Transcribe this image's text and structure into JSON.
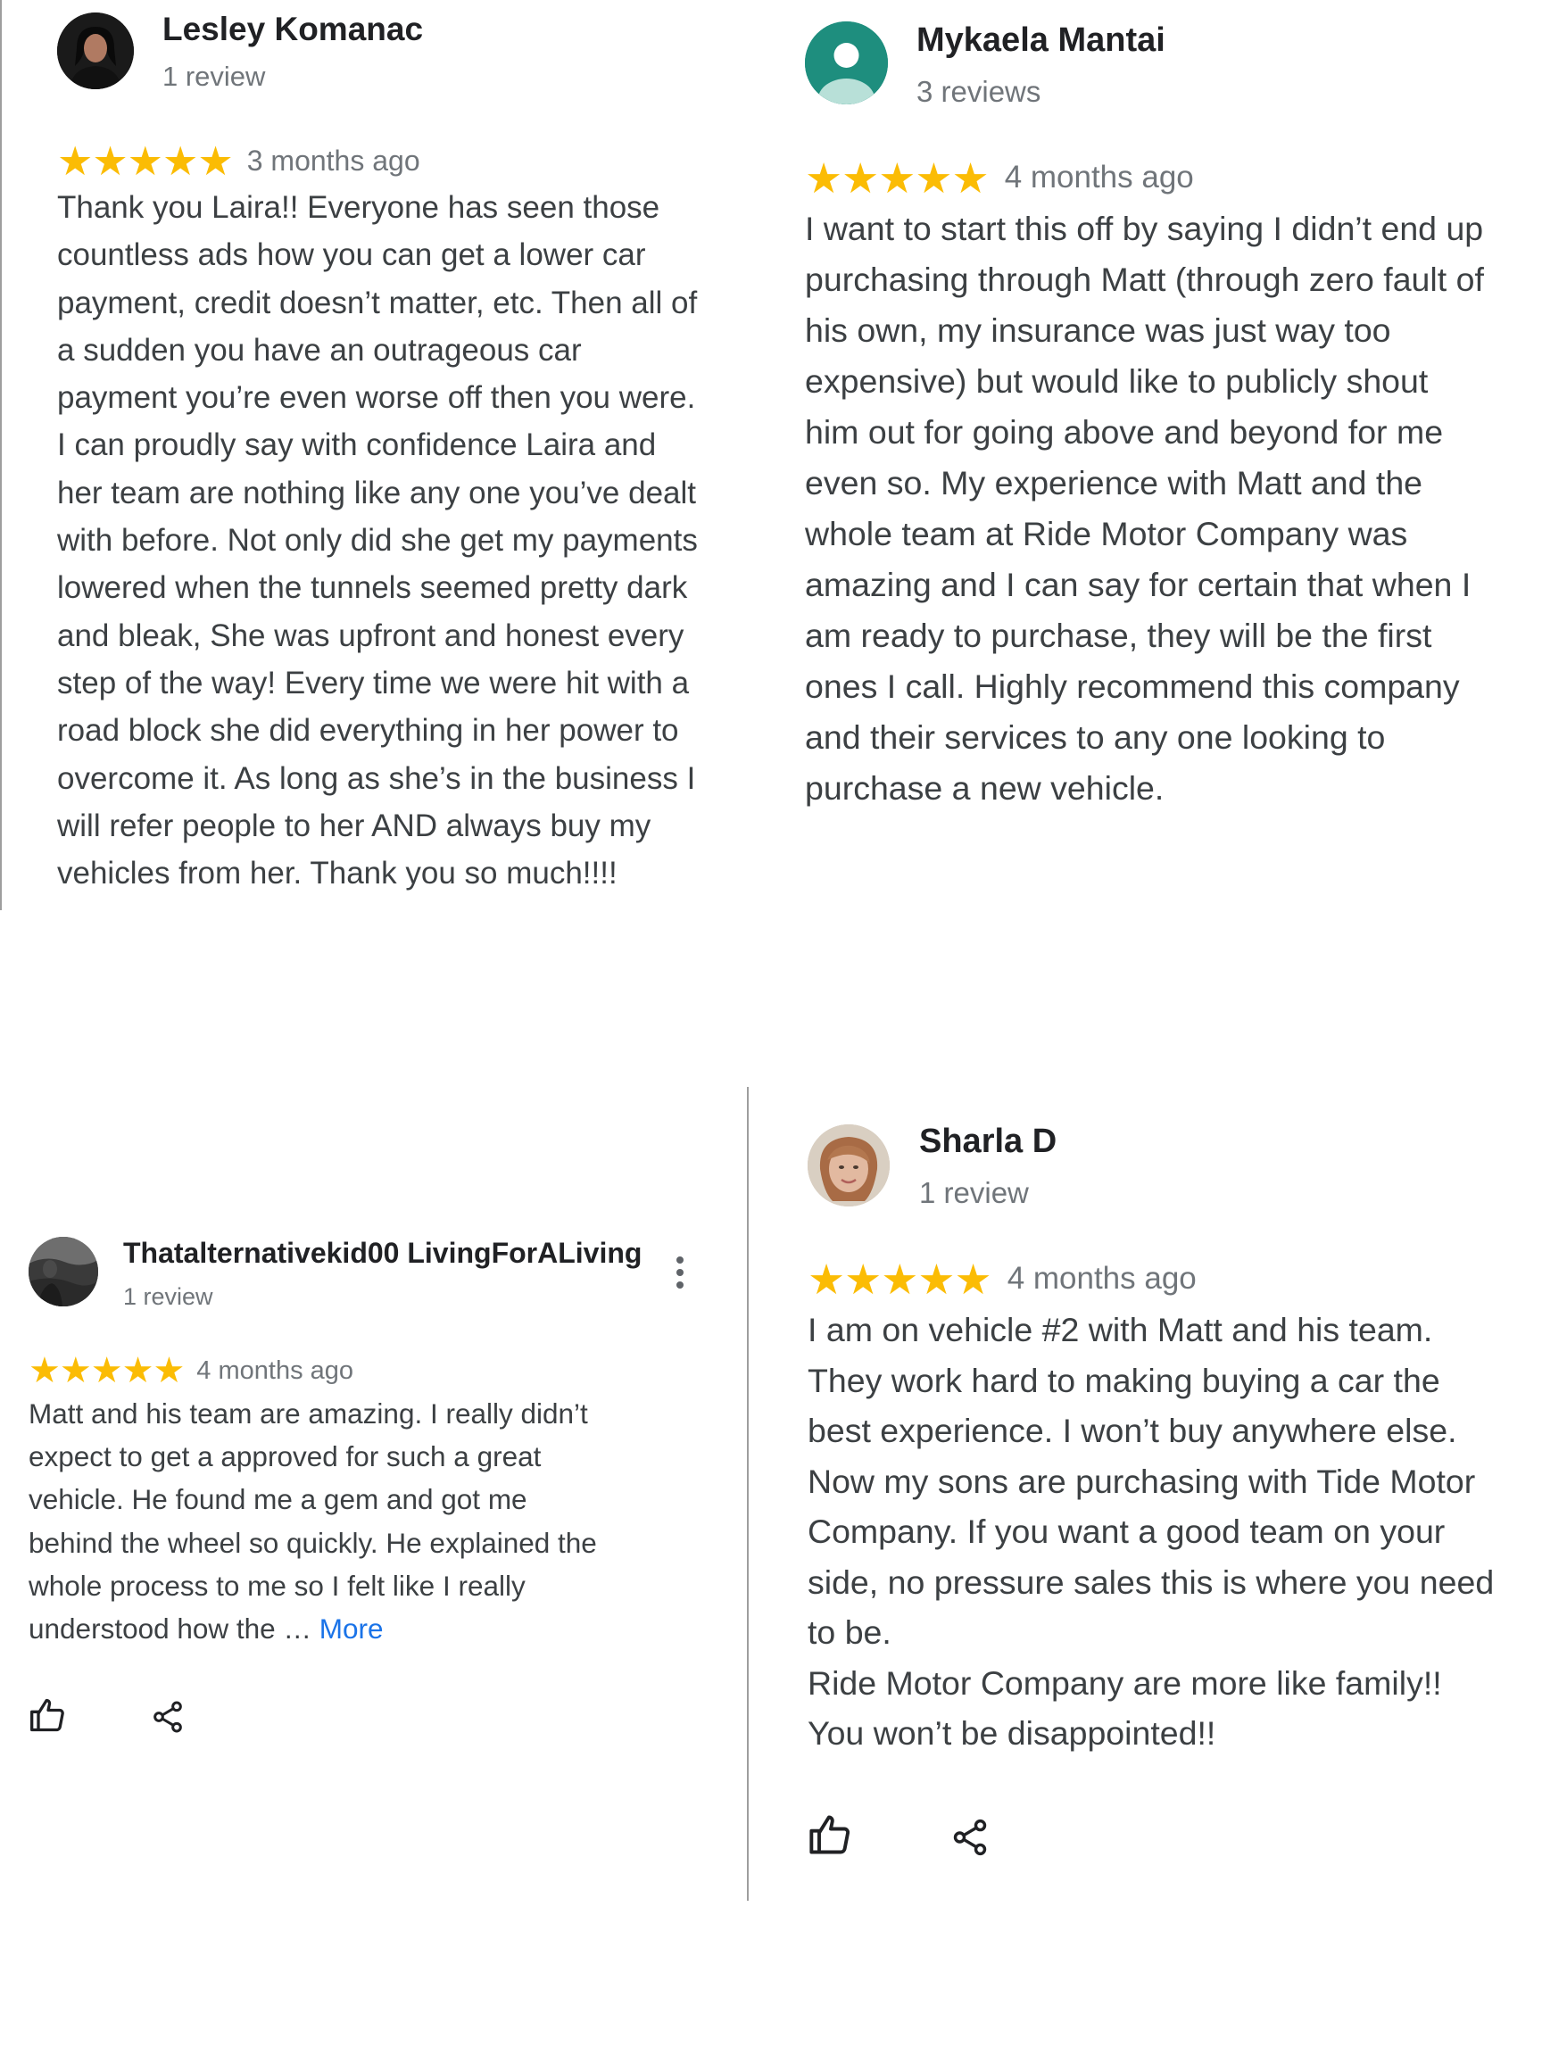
{
  "colors": {
    "star": "#fbbc04",
    "link": "#1a73e8",
    "mykaela_avatar": "#1e8e7e"
  },
  "reviews": [
    {
      "name": "Lesley Komanac",
      "count": "1 review",
      "rating": 5,
      "stars": "★★★★★",
      "ago": "3 months ago",
      "text": "Thank you Laira!! Everyone has seen those\ncountless ads how you can get a lower car\npayment, credit doesn’t matter, etc. Then all of\na sudden you have an outrageous car\npayment you’re even worse off then you were.\nI can proudly say with confidence Laira and\nher team are nothing like any one you’ve dealt\nwith before. Not only did she get my payments\nlowered when the tunnels seemed pretty dark\nand bleak, She was upfront and honest every\nstep of the way! Every time we were hit with a\nroad block she did everything in her power to\novercome it. As long as she’s in the business I\nwill refer people to her AND always buy my\nvehicles from her. Thank you so much!!!!"
    },
    {
      "name": "Mykaela Mantai",
      "count": "3 reviews",
      "rating": 5,
      "stars": "★★★★★",
      "ago": "4 months ago",
      "text": "I want to start this off by saying I didn’t end up\npurchasing through Matt (through zero fault of\nhis own, my insurance was just way too\nexpensive) but would like to publicly shout\nhim out for going above and beyond for me\neven so. My experience with Matt and the\nwhole team at Ride Motor Company was\namazing and I can say for certain that when I\nam ready to purchase, they will be the first\nones I call. Highly recommend this company\nand their services to any one looking to\npurchase a new vehicle."
    },
    {
      "name": "Thatalternativekid00 LivingForALiving",
      "count": "1 review",
      "rating": 5,
      "stars": "★★★★★",
      "ago": "4 months ago",
      "text": "Matt and his team are amazing. I really didn’t\nexpect to get a approved for such a great\nvehicle. He found me a gem and got me\nbehind the wheel so quickly. He explained the\nwhole process to me so I felt like I really\nunderstood how the … ",
      "more": "More"
    },
    {
      "name": "Sharla D",
      "count": "1 review",
      "rating": 5,
      "stars": "★★★★★",
      "ago": "4 months ago",
      "text": "I am on vehicle #2 with Matt and his team.\nThey work hard to making buying a car the\nbest experience. I won’t buy anywhere else.\nNow my sons are purchasing with Tide Motor\nCompany. If you want a good team on your\nside, no pressure sales this is where you need\nto be.\nRide Motor Company are more like family!!\nYou won’t be disappointed!!"
    }
  ]
}
